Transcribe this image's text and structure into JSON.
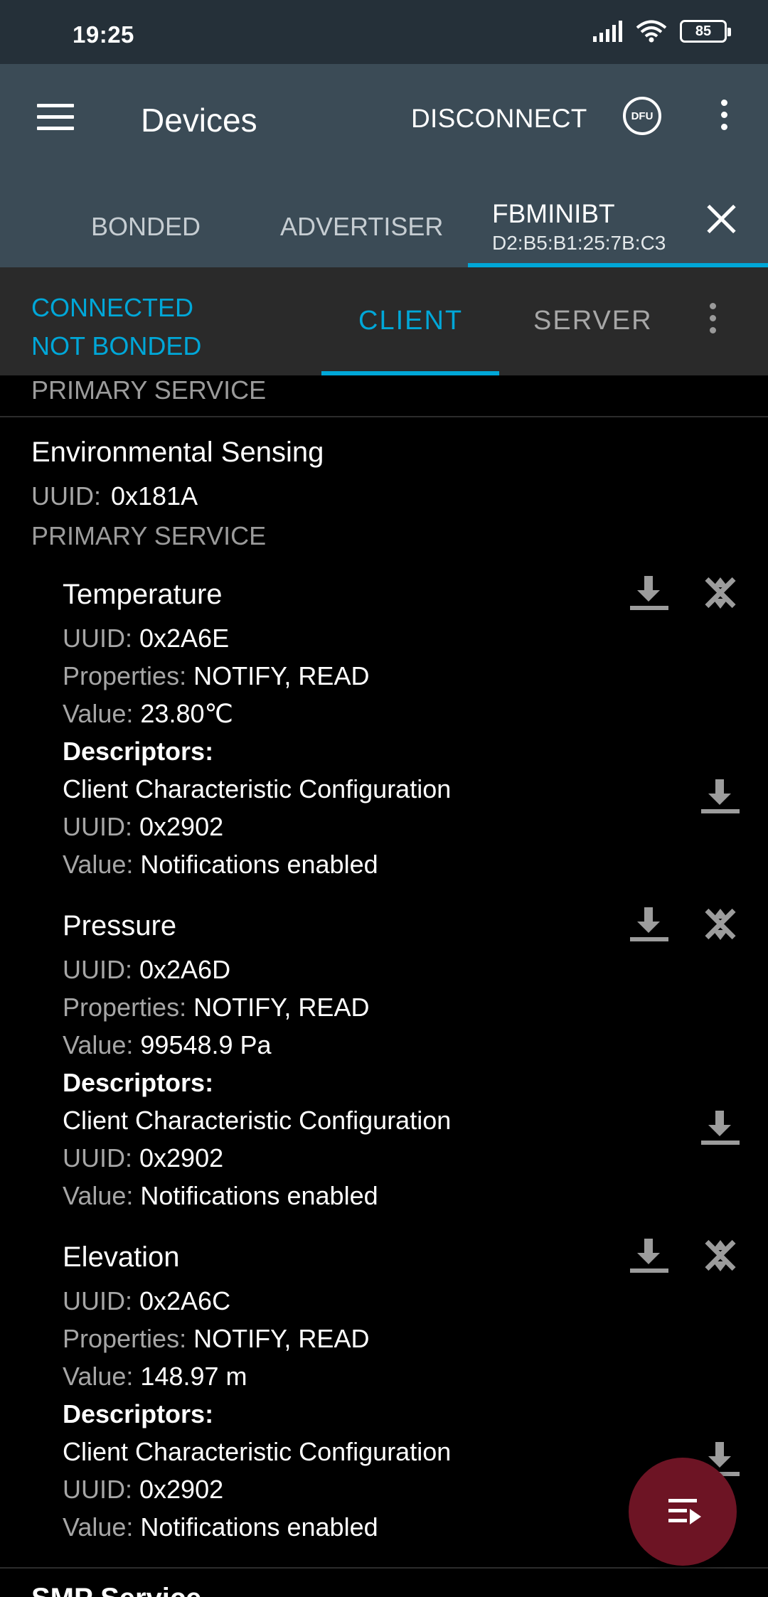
{
  "status_bar": {
    "time": "19:25",
    "battery": "85",
    "icons": [
      "signal-icon",
      "wifi-icon",
      "battery-icon"
    ]
  },
  "app_bar": {
    "title": "Devices",
    "disconnect_label": "DISCONNECT",
    "dfu_label": "DFU",
    "tabs": {
      "bonded": "BONDED",
      "advertiser": "ADVERTISER",
      "device_name": "FBMINIBT",
      "device_address": "D2:B5:B1:25:7B:C3"
    }
  },
  "connection": {
    "state": "CONNECTED",
    "bond_state": "NOT BONDED",
    "client_tab": "CLIENT",
    "server_tab": "SERVER"
  },
  "content": {
    "previous_service_type": "PRIMARY SERVICE",
    "service": {
      "name": "Environmental Sensing",
      "uuid_label": "UUID:",
      "uuid": "0x181A",
      "type": "PRIMARY SERVICE"
    },
    "labels": {
      "uuid": "UUID: ",
      "properties": "Properties: ",
      "value": "Value: ",
      "descriptors": "Descriptors:"
    },
    "characteristics": [
      {
        "name": "Temperature",
        "uuid": "0x2A6E",
        "properties": "NOTIFY, READ",
        "value": "23.80℃",
        "descriptor": {
          "name": "Client Characteristic Configuration",
          "uuid": "0x2902",
          "value": "Notifications enabled"
        }
      },
      {
        "name": "Pressure",
        "uuid": "0x2A6D",
        "properties": "NOTIFY, READ",
        "value": "99548.9 Pa",
        "descriptor": {
          "name": "Client Characteristic Configuration",
          "uuid": "0x2902",
          "value": "Notifications enabled"
        }
      },
      {
        "name": "Elevation",
        "uuid": "0x2A6C",
        "properties": "NOTIFY, READ",
        "value": "148.97 m",
        "descriptor": {
          "name": "Client Characteristic Configuration",
          "uuid": "0x2902",
          "value": "Notifications enabled"
        }
      }
    ],
    "next_service_partial": "SMP Service"
  },
  "colors": {
    "accent": "#00a7d8",
    "status_bar": "#253039",
    "app_bar": "#3b4b56",
    "connection_bar": "#2a2a2a",
    "fab": "#6d1424"
  }
}
